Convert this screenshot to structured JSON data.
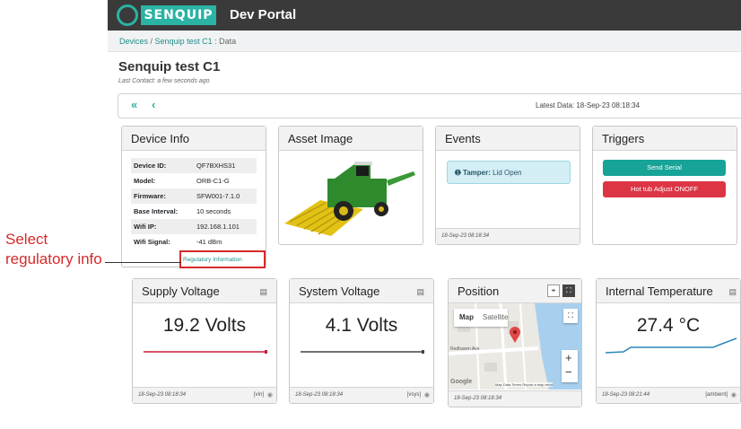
{
  "header": {
    "brand": "SENQUIP",
    "portal_title": "Dev Portal"
  },
  "breadcrumb": {
    "devices": "Devices",
    "device": "Senquip test C1",
    "suffix": " : Data"
  },
  "page": {
    "title": "Senquip test C1",
    "last_contact": "Last Contact: a few seconds ago"
  },
  "nav": {
    "first_icon": "«",
    "prev_icon": "‹",
    "latest_data": "Latest Data: 18-Sep-23 08:18:34"
  },
  "device_info": {
    "title": "Device Info",
    "rows": [
      {
        "key": "Device ID:",
        "value": "QF7BXHS31"
      },
      {
        "key": "Model:",
        "value": "ORB-C1-G"
      },
      {
        "key": "Firmware:",
        "value": "SFW001-7.1.0"
      },
      {
        "key": "Base Interval:",
        "value": "10 seconds"
      },
      {
        "key": "Wifi IP:",
        "value": "192.168.1.101"
      },
      {
        "key": "Wifi Signal:",
        "value": "-41 dBm"
      }
    ],
    "regulatory_link": "Regulatory Information"
  },
  "annotation": {
    "text": "Select regulatory info",
    "color": "#d62a2a"
  },
  "asset_image": {
    "title": "Asset Image"
  },
  "events": {
    "title": "Events",
    "alert_label": "Tamper:",
    "alert_text": "Lid Open",
    "footer_time": "18-Sep-23 08:18:34"
  },
  "triggers": {
    "title": "Triggers",
    "buttons": [
      {
        "label": "Send Serial",
        "color": "#17a398"
      },
      {
        "label": "Hot tub Adjust ONOFF",
        "color": "#dc3545"
      }
    ]
  },
  "supply_voltage": {
    "title": "Supply Voltage",
    "value": "19.2 Volts",
    "footer_time": "18-Sep-23 08:18:34",
    "tag": "[vin]",
    "line_color": "#c81d3a"
  },
  "system_voltage": {
    "title": "System Voltage",
    "value": "4.1 Volts",
    "footer_time": "18-Sep-23 08:18:34",
    "tag": "[vsys]",
    "line_color": "#444444"
  },
  "position": {
    "title": "Position",
    "map_tab": "Map",
    "satellite_tab": "Satellite",
    "street_label": "Redhaven Ave",
    "google_label": "Google",
    "attribution": "Map Data  Terms  Report a map error",
    "zoom_in": "+",
    "zoom_out": "−",
    "footer_time": "18-Sep-23 08:18:34"
  },
  "internal_temperature": {
    "title": "Internal Temperature",
    "value": "27.4 °C",
    "footer_time": "18-Sep-23 08:21:44",
    "tag": "[ambient]",
    "line_color": "#2a87b8"
  },
  "icons": {
    "chart": "chart-icon",
    "eye": "eye-icon",
    "fullscreen": "fullscreen-icon",
    "location": "location-icon"
  }
}
